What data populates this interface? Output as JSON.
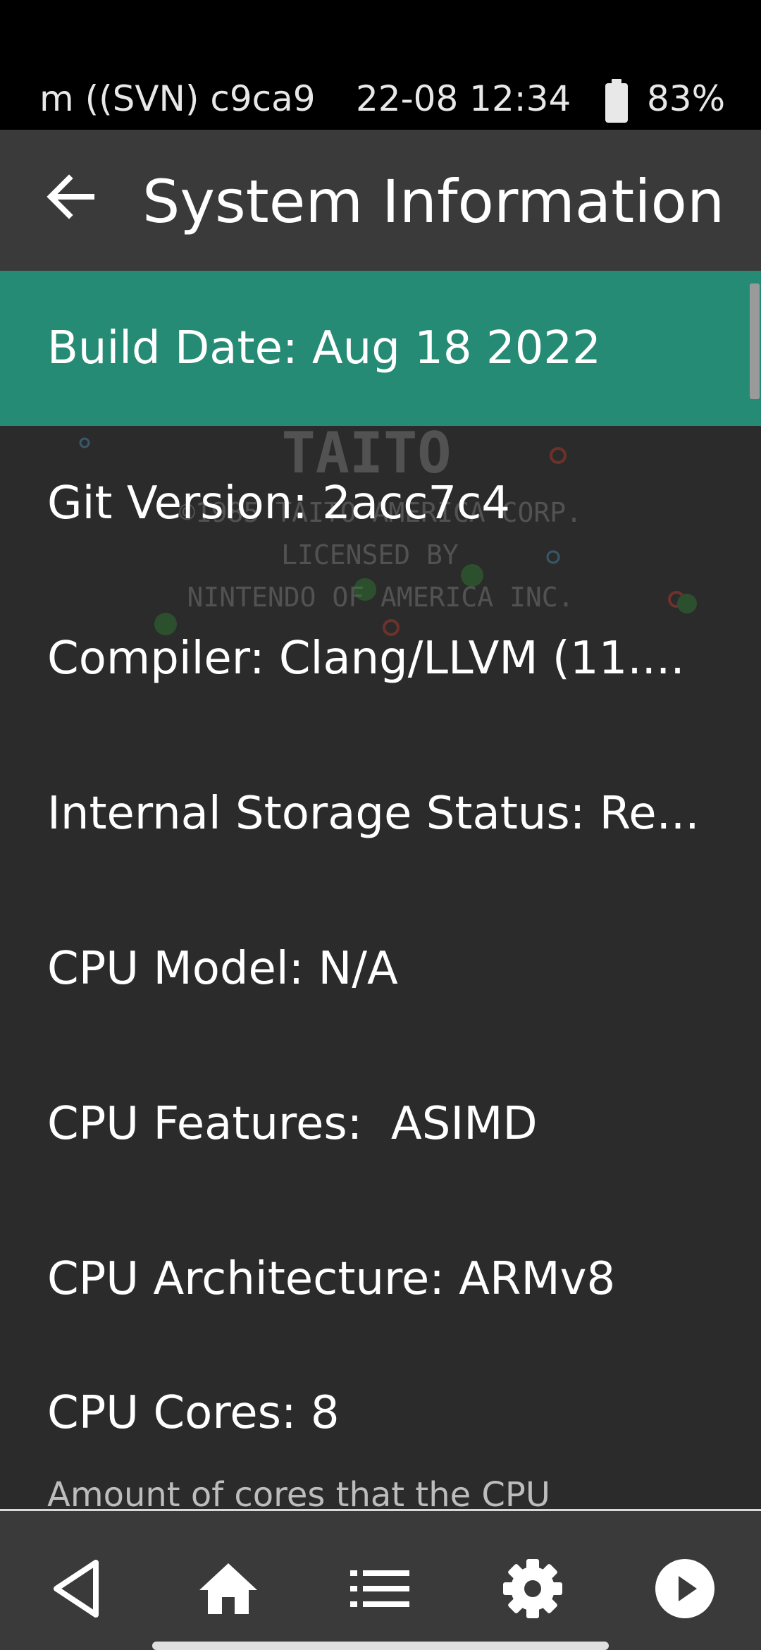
{
  "status_bar": {
    "left_text": "m ((SVN) c9ca9",
    "datetime": "22-08 12:34",
    "battery": "83%",
    "battery_icon": "battery-icon"
  },
  "app_bar": {
    "title": "System Information",
    "back_icon": "arrow-left-icon"
  },
  "list": {
    "items": [
      {
        "label": "Build Date: Aug 18 2022",
        "selected": true
      },
      {
        "label": "Git Version: 2acc7c4"
      },
      {
        "label": "Compiler: Clang/LLVM (11...."
      },
      {
        "label": "Internal Storage Status: Re..."
      },
      {
        "label": "CPU Model: N/A"
      },
      {
        "label": "CPU Features:  ASIMD"
      },
      {
        "label": "CPU Architecture: ARMv8"
      },
      {
        "label": "CPU Cores: 8",
        "sublabel": "Amount of cores that the CPU"
      }
    ]
  },
  "background_art": {
    "line1": "TAITO",
    "line2": "©1985 TAITO AMERICA CORP.",
    "line3": "LICENSED BY",
    "line4": "NINTENDO OF AMERICA INC."
  },
  "bottom_nav": {
    "buttons": [
      "back-triangle-icon",
      "home-icon",
      "list-icon",
      "gear-icon",
      "play-circle-icon"
    ]
  },
  "colors": {
    "status_bg": "#000000",
    "app_bar_bg": "#3a3a3a",
    "list_bg": "#2b2b2b",
    "selected_bg": "#268b74",
    "text": "#ffffff"
  }
}
